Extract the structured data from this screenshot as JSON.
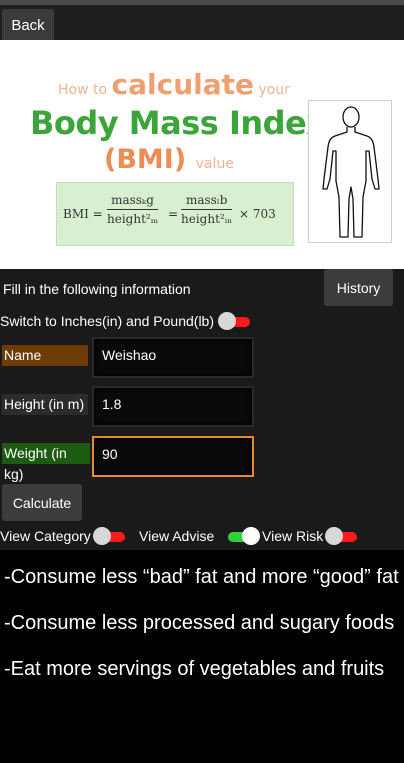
{
  "toolbar": {
    "back_label": "Back"
  },
  "hero": {
    "howto_prefix": "How to ",
    "howto_big": "calculate",
    "howto_suffix": " your",
    "title": "Body Mass Index",
    "bmi": "(BMI)",
    "value_word": "value",
    "formula": {
      "lhs": "BMI =",
      "num1": "massₖg",
      "den1": "height²ₘ",
      "eq": "=",
      "num2": "massₗb",
      "den2": "height²ᵢₙ",
      "mul": "× 703"
    },
    "figure_icon": "human-silhouette-icon"
  },
  "form": {
    "heading": "Fill in the following information",
    "history_label": "History",
    "unit_switch_label": "Switch to Inches(in) and Pound(lb)",
    "unit_switch_on": false,
    "fields": {
      "name_label": "Name",
      "name_value": "Weishao",
      "height_label": "Height (in m)",
      "height_value": "1.8",
      "weight_label": "Weight (in kg)",
      "weight_value": "90"
    },
    "calculate_label": "Calculate"
  },
  "views": {
    "category_label": "View Category",
    "category_on": false,
    "advise_label": "View Advise",
    "advise_on": true,
    "risk_label": "View Risk",
    "risk_on": false
  },
  "advice": [
    "-Consume less “bad” fat and more “good” fat",
    "-Consume less processed and sugary foods",
    "-Eat more servings of vegetables and fruits"
  ],
  "colors": {
    "name_label_bg": "#6e3c06",
    "weight_label_bg": "#1d5a12",
    "focus_border": "#e8892e",
    "toggle_off": "#ff1a1a",
    "toggle_on": "#2ed23f"
  }
}
